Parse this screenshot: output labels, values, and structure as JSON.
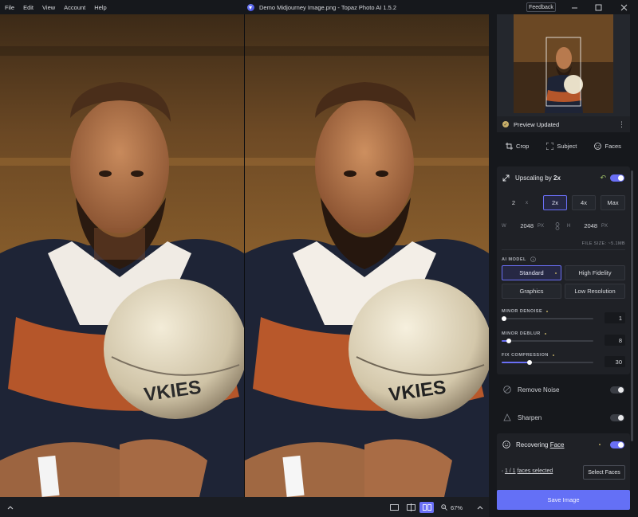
{
  "menu": [
    "File",
    "Edit",
    "View",
    "Account",
    "Help"
  ],
  "window": {
    "title": "Demo Midjourney Image.png - Topaz Photo AI 1.5.2",
    "feedback_label": "Feedback",
    "minimize_icon": "minimize-icon",
    "maximize_icon": "maximize-icon",
    "close_icon": "close-icon"
  },
  "bottom_bar": {
    "zoom_level": "67%"
  },
  "preview": {
    "status": "Preview Updated"
  },
  "tools": {
    "crop": "Crop",
    "subject": "Subject",
    "faces": "Faces"
  },
  "upscaling": {
    "title_prefix": "Upscaling by",
    "title_scale": "2x",
    "enabled": true,
    "scale_value": "2",
    "scale_suffix": "x",
    "presets": [
      "2x",
      "4x",
      "Max"
    ],
    "active_preset": "2x",
    "width_label": "W",
    "width_value": "2048",
    "width_unit": "PX",
    "height_label": "H",
    "height_value": "2048",
    "height_unit": "PX",
    "file_size": "FILE SIZE: ~5.1MB",
    "ai_model_label": "AI MODEL",
    "models": [
      "Standard",
      "High Fidelity",
      "Graphics",
      "Low Resolution"
    ],
    "active_model": "Standard",
    "sliders": [
      {
        "label": "MINOR DENOISE",
        "value": "1",
        "fraction": 0.02
      },
      {
        "label": "MINOR DEBLUR",
        "value": "8",
        "fraction": 0.08
      },
      {
        "label": "FIX COMPRESSION",
        "value": "30",
        "fraction": 0.3
      }
    ]
  },
  "remove_noise": {
    "label": "Remove Noise",
    "enabled": false
  },
  "sharpen": {
    "label": "Sharpen",
    "enabled": false
  },
  "faces": {
    "title_prefix": "Recovering",
    "title_link": "Face",
    "enabled": true,
    "selected_count": "1 / 1",
    "selected_suffix": "faces selected",
    "select_button": "Select Faces"
  },
  "save_button": "Save Image",
  "colors": {
    "accent": "#6a6ff5",
    "save": "#6470f6",
    "panel_bg": "#1f2126",
    "app_bg": "#16181c",
    "status_dot": "#b9a763"
  }
}
